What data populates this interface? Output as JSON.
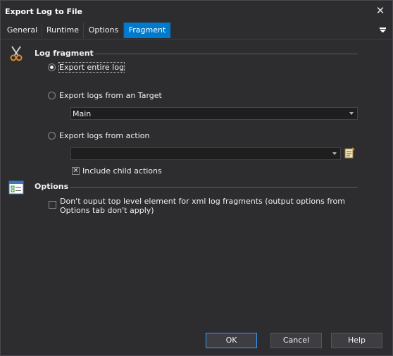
{
  "window": {
    "title": "Export Log to File",
    "close_glyph": "✕"
  },
  "tabs": [
    {
      "label": "General"
    },
    {
      "label": "Runtime"
    },
    {
      "label": "Options"
    },
    {
      "label": "Fragment"
    }
  ],
  "active_tab": "Fragment",
  "fragment": {
    "header": "Log fragment",
    "icon": "scissors-icon",
    "radios": [
      {
        "label": "Export entire log",
        "checked": true
      },
      {
        "label": "Export logs from an Target",
        "checked": false
      },
      {
        "label": "Export logs from action",
        "checked": false
      }
    ],
    "target_value": "Main",
    "action_value": "",
    "include_child_label": "Include child actions",
    "include_child_checked": true,
    "check_glyph": "✕"
  },
  "options": {
    "header": "Options",
    "icon": "checklist-window-icon",
    "no_top_level_label": "Don't ouput top level element for xml log fragments (output options from Options tab don't apply)",
    "no_top_level_checked": false
  },
  "buttons": {
    "ok": "OK",
    "cancel": "Cancel",
    "help": "Help"
  },
  "colors": {
    "accent": "#007acc",
    "background": "#2d2d30",
    "field": "#1e1e1e"
  }
}
